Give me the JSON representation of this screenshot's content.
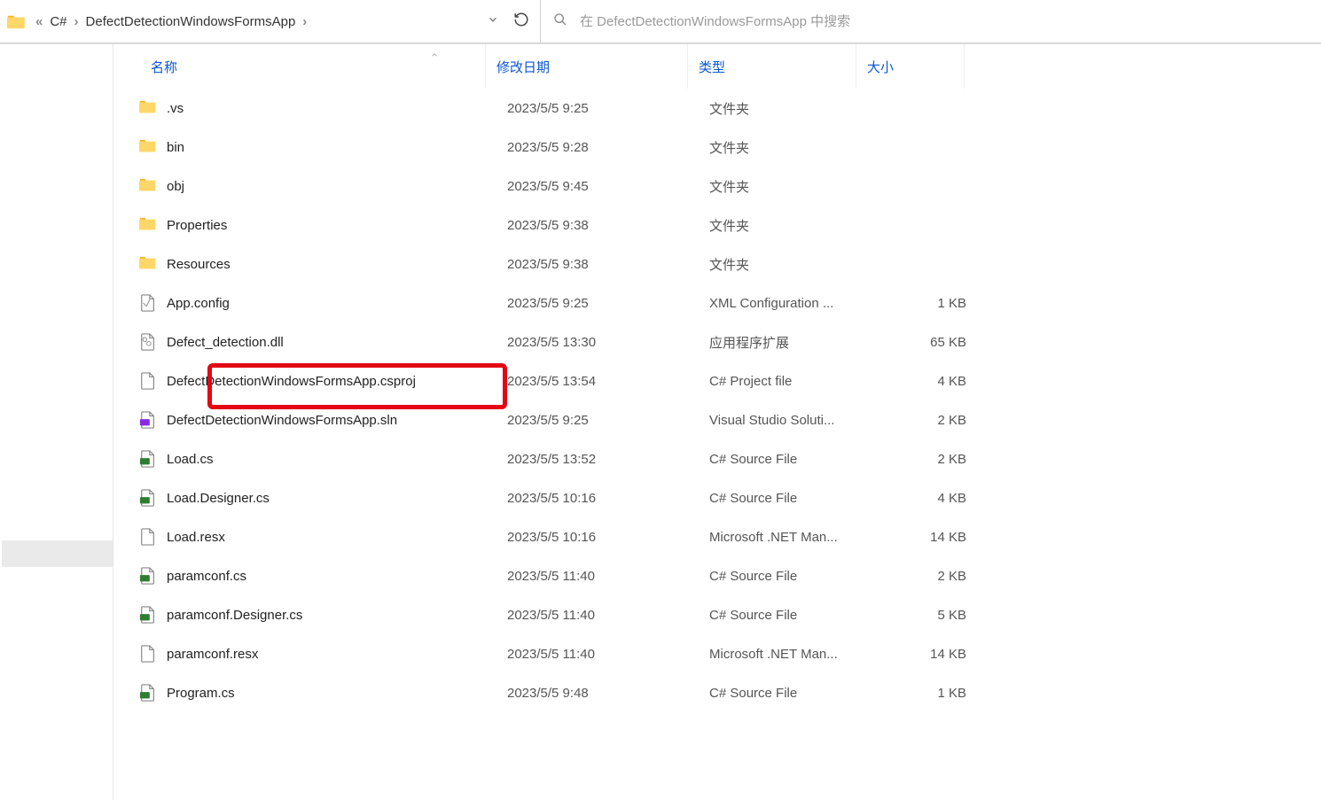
{
  "breadcrumb": {
    "items": [
      "«",
      "C#",
      "›",
      "DefectDetectionWindowsFormsApp",
      "›"
    ]
  },
  "search": {
    "placeholder": "在 DefectDetectionWindowsFormsApp 中搜索"
  },
  "columns": {
    "name": "名称",
    "date": "修改日期",
    "type": "类型",
    "size": "大小"
  },
  "rows": [
    {
      "icon": "folder",
      "name": ".vs",
      "date": "2023/5/5 9:25",
      "type": "文件夹",
      "size": ""
    },
    {
      "icon": "folder",
      "name": "bin",
      "date": "2023/5/5 9:28",
      "type": "文件夹",
      "size": ""
    },
    {
      "icon": "folder",
      "name": "obj",
      "date": "2023/5/5 9:45",
      "type": "文件夹",
      "size": ""
    },
    {
      "icon": "folder",
      "name": "Properties",
      "date": "2023/5/5 9:38",
      "type": "文件夹",
      "size": ""
    },
    {
      "icon": "folder",
      "name": "Resources",
      "date": "2023/5/5 9:38",
      "type": "文件夹",
      "size": ""
    },
    {
      "icon": "file-config",
      "name": "App.config",
      "date": "2023/5/5 9:25",
      "type": "XML Configuration ...",
      "size": "1 KB"
    },
    {
      "icon": "file-dll",
      "name": "Defect_detection.dll",
      "date": "2023/5/5 13:30",
      "type": "应用程序扩展",
      "size": "65 KB"
    },
    {
      "icon": "file",
      "name": "DefectDetectionWindowsFormsApp.csproj",
      "date": "2023/5/5 13:54",
      "type": "C# Project file",
      "size": "4 KB"
    },
    {
      "icon": "file-sln",
      "name": "DefectDetectionWindowsFormsApp.sln",
      "date": "2023/5/5 9:25",
      "type": "Visual Studio Soluti...",
      "size": "2 KB"
    },
    {
      "icon": "file-cs",
      "name": "Load.cs",
      "date": "2023/5/5 13:52",
      "type": "C# Source File",
      "size": "2 KB"
    },
    {
      "icon": "file-cs",
      "name": "Load.Designer.cs",
      "date": "2023/5/5 10:16",
      "type": "C# Source File",
      "size": "4 KB"
    },
    {
      "icon": "file",
      "name": "Load.resx",
      "date": "2023/5/5 10:16",
      "type": "Microsoft .NET Man...",
      "size": "14 KB"
    },
    {
      "icon": "file-cs",
      "name": "paramconf.cs",
      "date": "2023/5/5 11:40",
      "type": "C# Source File",
      "size": "2 KB"
    },
    {
      "icon": "file-cs",
      "name": "paramconf.Designer.cs",
      "date": "2023/5/5 11:40",
      "type": "C# Source File",
      "size": "5 KB"
    },
    {
      "icon": "file",
      "name": "paramconf.resx",
      "date": "2023/5/5 11:40",
      "type": "Microsoft .NET Man...",
      "size": "14 KB"
    },
    {
      "icon": "file-cs",
      "name": "Program.cs",
      "date": "2023/5/5 9:48",
      "type": "C# Source File",
      "size": "1 KB"
    }
  ]
}
